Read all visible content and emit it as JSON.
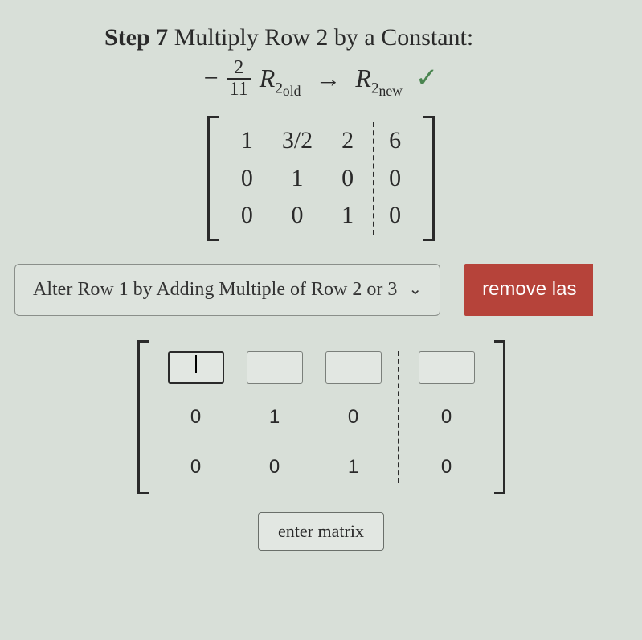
{
  "header": {
    "step_label": "Step 7",
    "title_rest": " Multiply Row 2 by a Constant:"
  },
  "equation": {
    "minus": "−",
    "frac_num": "2",
    "frac_den": "11",
    "R": "R",
    "two": "2",
    "sub_old": "old",
    "arrow": "→",
    "sub_new": "new",
    "check": "✓"
  },
  "matrix1": {
    "c1": [
      "1",
      "0",
      "0"
    ],
    "c2": [
      "3/2",
      "1",
      "0"
    ],
    "c3": [
      "2",
      "0",
      "1"
    ],
    "c4": [
      "6",
      "0",
      "0"
    ]
  },
  "dropdown": {
    "label": "Alter Row 1 by Adding Multiple of Row 2 or 3"
  },
  "remove_button": {
    "label": "remove las"
  },
  "input_matrix": {
    "row1": [
      "",
      "",
      "",
      ""
    ],
    "row2": [
      "0",
      "1",
      "0",
      "0"
    ],
    "row3": [
      "0",
      "0",
      "1",
      "0"
    ]
  },
  "enter_button": {
    "label": "enter matrix"
  }
}
